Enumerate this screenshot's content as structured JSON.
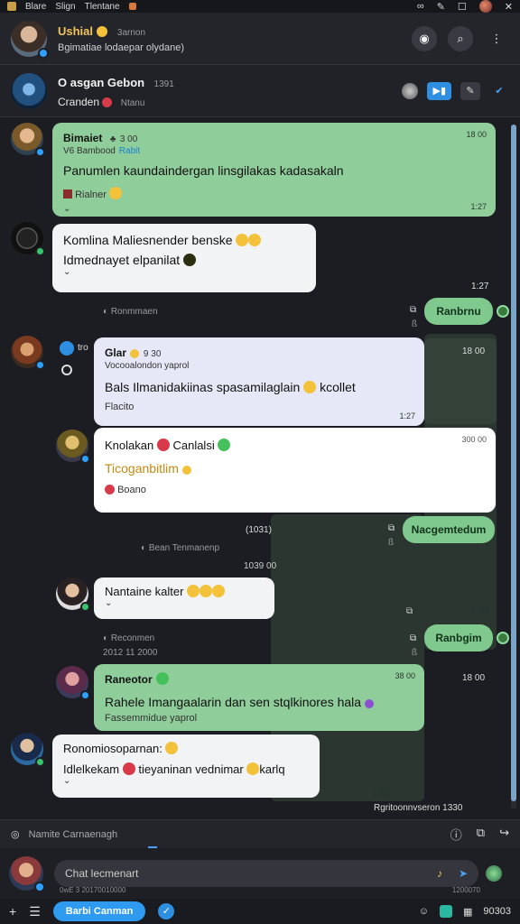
{
  "statusbar": {
    "items": [
      "Blare",
      "Slign",
      "Tlentane"
    ],
    "icons": [
      "infinity-icon",
      "edit-icon",
      "window-icon",
      "close-icon"
    ]
  },
  "header": {
    "name": "Ushial",
    "status": "3arnon",
    "subtitle": "Bgimatiae lodaepar olydane)"
  },
  "channel": {
    "title": "O asgan Gebon",
    "count": "1391",
    "subtitle": "Cranden",
    "subtitle_note": "Ntanu"
  },
  "messages": [
    {
      "name": "Bimaiet",
      "name_extra": "3 00",
      "handle": "Bambood",
      "handle_link": "Rabit",
      "text": "Panumlen kaundaindergan linsgilakas kadasakaln",
      "small": "Rialner",
      "time_top": "18 00",
      "time_bottom": "1:27"
    },
    {
      "text_1": "Komlina Maliesnender benske",
      "text_2": "Idmednayet elpanilat",
      "time_bottom": "1:27"
    },
    {
      "system": "Ronmmaen",
      "pill": "Ranbrnu"
    },
    {
      "side_handle": "tro",
      "name": "Glar",
      "name_extra": "9 30",
      "handle": "Vocooalondon yaprol",
      "text": "Bals Ilmanidakiinas spasamilaglain",
      "text_extra": "kcollet",
      "small": "Flacito",
      "time_top": "18 00",
      "time_bottom": "1:27"
    },
    {
      "title": "Knolakan",
      "title_extra": "Canlalsi",
      "gold_text": "Ticoganbitlim",
      "small": "Boano",
      "time_top": "300 00"
    },
    {
      "sys_left": "(1031)",
      "sys_center": "Bean Tenmanenp",
      "sys_time": "1039 00",
      "pill": "Nacgemtedum",
      "time_bottom": "1:27"
    },
    {
      "text": "Nantaine kalter",
      "time_bottom": "1:27"
    },
    {
      "system": "Reconmen",
      "system_time": "2012 11 2000",
      "pill": "Ranbgim"
    },
    {
      "name": "Raneotor",
      "text": "Rahele Imangaalarin dan sen stqlkinores hala",
      "small": "Fassemmidue yaprol",
      "time_top": "38 00",
      "time_top2": "18 00"
    },
    {
      "text_1": "Ronomiosoparnan:",
      "text_2": "Idlelkekam",
      "text_2b": "tieyaninan vednimar",
      "text_2c": "karlq",
      "time_bottom": "1:27"
    }
  ],
  "chat_footer": "Rgritoonnvseron 1330",
  "typing": {
    "text": "Namite Carnaenagh"
  },
  "composer": {
    "placeholder": "Chat lecmenart",
    "under_left": "0wE 3 20170010000",
    "under_right": "1200070"
  },
  "bottombar": {
    "send_label": "Barbi Canman",
    "right_text": "90303"
  }
}
